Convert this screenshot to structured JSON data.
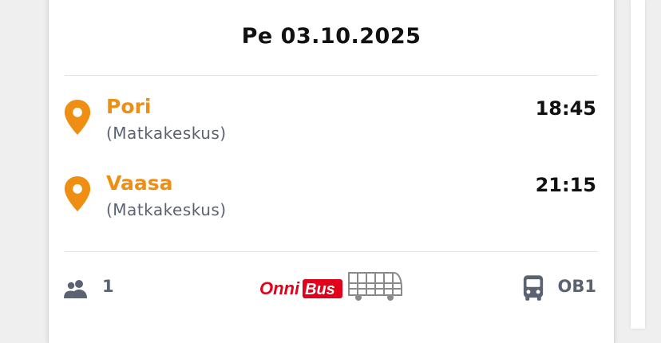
{
  "trip": {
    "date": "Pe 03.10.2025",
    "departure": {
      "city": "Pori",
      "station": "(Matkakeskus)",
      "time": "18:45"
    },
    "arrival": {
      "city": "Vaasa",
      "station": "(Matkakeskus)",
      "time": "21:15"
    }
  },
  "footer": {
    "passenger_icon": "people-icon",
    "passenger_count": "1",
    "operator_logo_text": "OnniBus",
    "vehicle_icon": "bus-icon",
    "line_code": "OB1"
  },
  "colors": {
    "accent_orange": "#ee8e12",
    "logo_red": "#e2001a",
    "muted_text": "#5b6272"
  }
}
